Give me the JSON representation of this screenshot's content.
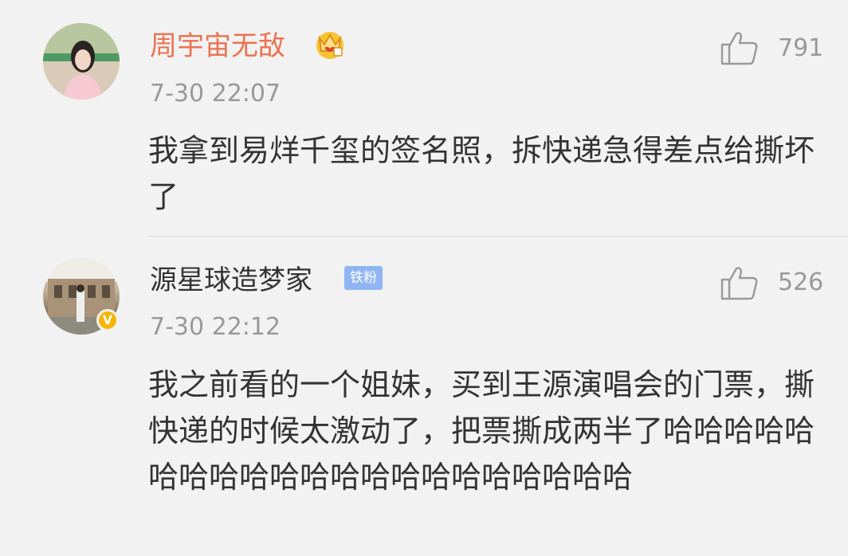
{
  "comments": [
    {
      "username": "周宇宙无敌",
      "badge": "crown-badge-icon",
      "time": "7-30 22:07",
      "text": "我拿到易烊千玺的签名照，拆快递急得差点给撕坏了",
      "likes": "791"
    },
    {
      "username": "源星球造梦家",
      "tag": "铁粉",
      "verified": "V",
      "time": "7-30 22:12",
      "text": "我之前看的一个姐妹，买到王源演唱会的门票，撕快递的时候太激动了，把票撕成两半了哈哈哈哈哈哈哈哈哈哈哈哈哈哈哈哈哈哈哈哈哈",
      "likes": "526"
    }
  ],
  "colors": {
    "background": "#f2f2f2",
    "username_vip": "#eb7350",
    "username_normal": "#333333",
    "meta_gray": "#999999",
    "tag_blue": "#8fb5f2",
    "verified_gold": "#f7b500"
  }
}
